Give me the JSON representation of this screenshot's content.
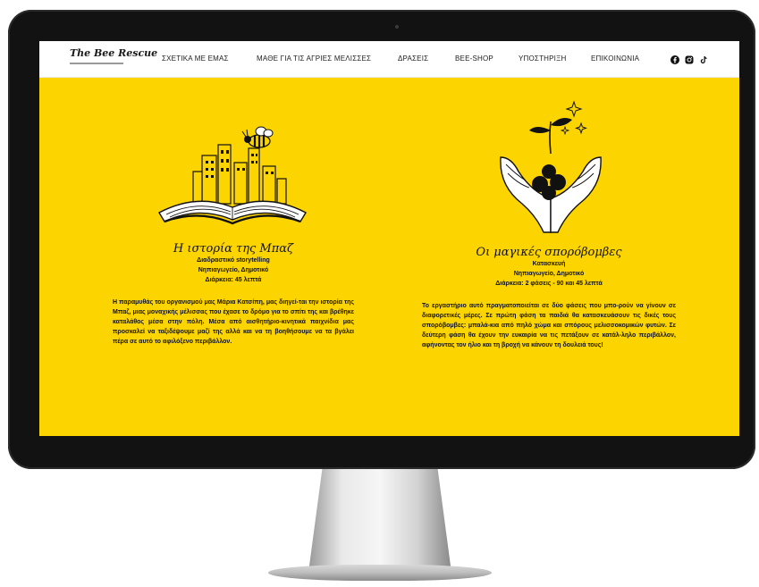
{
  "nav": {
    "logo_text": "The Bee Rescue",
    "items": [
      {
        "label": "ΣΧΕΤΙΚΑ ΜΕ ΕΜΑΣ"
      },
      {
        "label": "ΜΑΘΕ ΓΙΑ ΤΙΣ ΑΓΡΙΕΣ ΜΕΛΙΣΣΕΣ"
      },
      {
        "label": "ΔΡΑΣΕΙΣ"
      },
      {
        "label": "BEE-SHOP"
      },
      {
        "label": "ΥΠΟΣΤΗΡΙΞΗ"
      },
      {
        "label": "ΕΠΙΚΟΙΝΩΝΙΑ"
      }
    ],
    "social_icons": [
      "facebook-icon",
      "instagram-icon",
      "tiktok-icon"
    ]
  },
  "activities": [
    {
      "title": "Η ιστορία της Μπαζ",
      "type": "Διαδραστικό storytelling",
      "audience": "Νηπιαγωγείο, Δημοτικό",
      "duration": "Διάρκεια: 45 λεπτά",
      "description": "Η παραμυθάς του οργανισμού μας Μάρια Κατσίπη, μας διηγεί-ται την ιστορία της Μπαζ, μιας μοναχικής μέλισσας που έχασε το δρόμο για το σπίτι της και βρέθηκε καταλάθος μέσα στην πόλη. Μέσα από αισθητήριο-κινητικά παιχνίδια μας προσκαλεί να ταξιδέψουμε μαζί της αλλά και να τη βοηθήσουμε να τα βγάλει πέρα σε αυτό το αφιλόξενο περιβάλλον.",
      "illustration": "open-book-city-bee"
    },
    {
      "title": "Οι μαγικές σπορόβομβες",
      "type": "Κατασκευή",
      "audience": "Νηπιαγωγείο, Δημοτικό",
      "duration": "Διάρκεια: 2 φάσεις - 90 και 45 λεπτά",
      "description": "Το εργαστήριο αυτό πραγματοποιείται σε δύο φάσεις που μπο-ρούν να γίνουν σε διαφορετικές μέρες. Σε πρώτη φάση τα παιδιά θα κατασκευάσουν τις δικές τους σπορόβομβες: μπαλά-κια από πηλό χώμα και σπόρους μελισσοκομικών φυτών. Σε δεύτερη φάση θα έχουν την ευκαιρία να τις πετάξουν σε κατάλ-ληλο περιβάλλον, αφήνοντας τον ήλιο και τη βροχή να κάνουν τη δουλειά τους!",
      "illustration": "hands-holding-seed-bombs"
    }
  ],
  "colors": {
    "background": "#fcd400",
    "nav_background": "#ffffff",
    "text": "#111111",
    "bezel": "#121212"
  }
}
